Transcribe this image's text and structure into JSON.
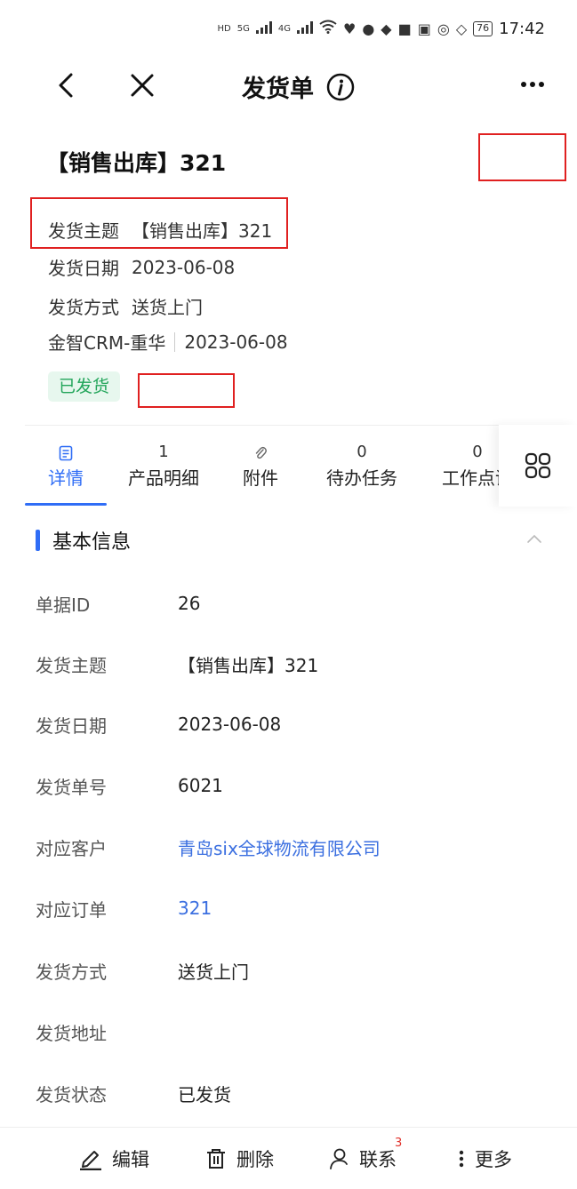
{
  "status_bar": {
    "network_labels": [
      "HD",
      "5G",
      "4G"
    ],
    "battery": "76",
    "time": "17:42"
  },
  "nav": {
    "title": "发货单",
    "back_icon": "chevron-left-icon",
    "close_icon": "close-icon",
    "info_icon": "info-icon",
    "more_icon": "more-horizontal-icon"
  },
  "header": {
    "title": "【销售出库】321",
    "meta": [
      {
        "label": "发货主题",
        "value": "【销售出库】321"
      },
      {
        "label": "发货日期",
        "value": "2023-06-08"
      },
      {
        "label": "发货方式",
        "value": "送货上门"
      }
    ],
    "owner": "金智CRM-重华",
    "owner_date": "2023-06-08",
    "status_tag": "已发货"
  },
  "tabs": [
    {
      "top": "",
      "label": "详情",
      "active": true
    },
    {
      "top": "1",
      "label": "产品明细",
      "active": false
    },
    {
      "top": "",
      "label": "附件",
      "active": false
    },
    {
      "top": "0",
      "label": "待办任务",
      "active": false
    },
    {
      "top": "0",
      "label": "工作点评",
      "active": false
    }
  ],
  "section": {
    "title": "基本信息"
  },
  "fields": [
    {
      "label": "单据ID",
      "value": "26",
      "link": false
    },
    {
      "label": "发货主题",
      "value": "【销售出库】321",
      "link": false
    },
    {
      "label": "发货日期",
      "value": "2023-06-08",
      "link": false
    },
    {
      "label": "发货单号",
      "value": "6021",
      "link": false
    },
    {
      "label": "对应客户",
      "value": "青岛six全球物流有限公司",
      "link": true
    },
    {
      "label": "对应订单",
      "value": "321",
      "link": true
    },
    {
      "label": "发货方式",
      "value": "送货上门",
      "link": false
    },
    {
      "label": "发货地址",
      "value": "",
      "link": false
    },
    {
      "label": "发货状态",
      "value": "已发货",
      "link": false
    }
  ],
  "bottom_bar": {
    "edit": "编辑",
    "delete": "删除",
    "contact": "联系",
    "contact_badge": "3",
    "more": "更多"
  },
  "colors": {
    "accent": "#2f6df6",
    "link": "#3b6fe0",
    "status_green": "#22a55a",
    "status_green_bg": "#e7f7ee",
    "badge_red": "#e0302a",
    "annotation_red": "#e02020"
  }
}
